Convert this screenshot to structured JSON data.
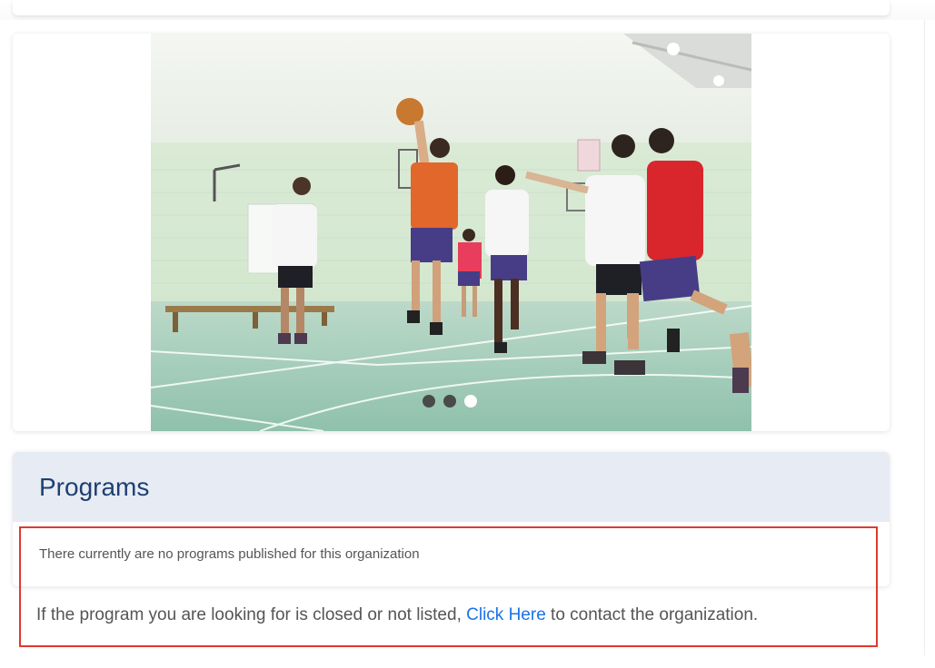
{
  "carousel": {
    "slide_count": 3,
    "active_slide": 3,
    "dots": [
      {
        "label": "slide-1",
        "active": false
      },
      {
        "label": "slide-2",
        "active": false
      },
      {
        "label": "slide-3",
        "active": true
      }
    ]
  },
  "programs": {
    "title": "Programs",
    "empty_message": "There currently are no programs published for this organization",
    "contact_prefix": "If the program you are looking for is closed or not listed, ",
    "contact_link": "Click Here",
    "contact_suffix": " to contact the organization."
  },
  "colors": {
    "header_bg": "#e7ebf3",
    "title": "#1f3f72",
    "link": "#1a73e8",
    "highlight": "#e0392f"
  }
}
